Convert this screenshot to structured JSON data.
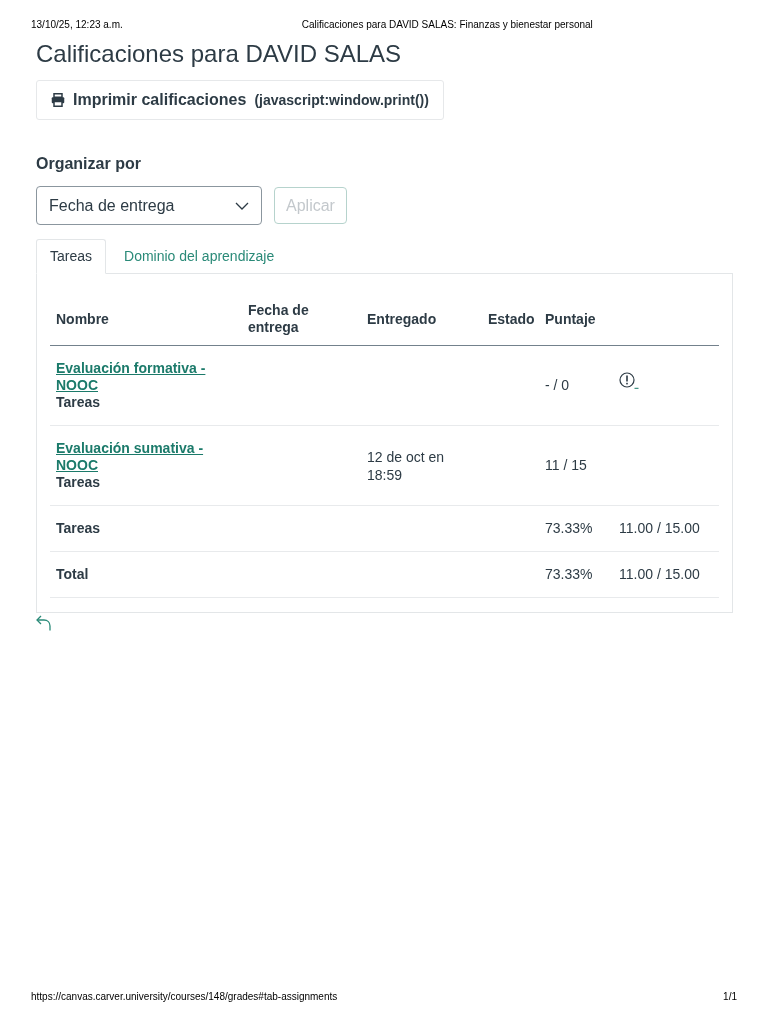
{
  "print_header": {
    "datetime": "13/10/25, 12:23 a.m.",
    "title": "Calificaciones para DAVID SALAS: Finanzas y bienestar personal"
  },
  "page": {
    "title": "Calificaciones para DAVID SALAS"
  },
  "print_button": {
    "label": "Imprimir calificaciones",
    "url": "(javascript:window.print())"
  },
  "sort": {
    "label": "Organizar por",
    "value": "Fecha de entrega",
    "apply_button": {
      "label": "Aplicar",
      "disabled": true
    }
  },
  "tabs": [
    {
      "label": "Tareas",
      "selected": true
    },
    {
      "label": "Dominio del aprendizaje",
      "selected": false
    }
  ],
  "table": {
    "columns": [
      "Nombre",
      "Fecha de entrega",
      "Entregado",
      "Estado",
      "Puntaje"
    ],
    "rows": [
      {
        "kind": "assignment",
        "name": "Evaluación formativa - NOOC",
        "group": "Tareas",
        "score": "- / 0",
        "warning": true
      },
      {
        "kind": "assignment",
        "name": "Evaluación sumativa - NOOC",
        "group": "Tareas",
        "submitted": "12 de oct en 18:59",
        "score": "11 / 15",
        "warning": false
      },
      {
        "kind": "total",
        "label": "Tareas",
        "percent": "73.33%",
        "points": "11.00 / 15.00"
      },
      {
        "kind": "total",
        "label": "Total",
        "percent": "73.33%",
        "points": "11.00 / 15.00"
      }
    ]
  },
  "footer": {
    "url": "https://canvas.carver.university/courses/148/grades#tab-assignments",
    "page": "1/1"
  }
}
